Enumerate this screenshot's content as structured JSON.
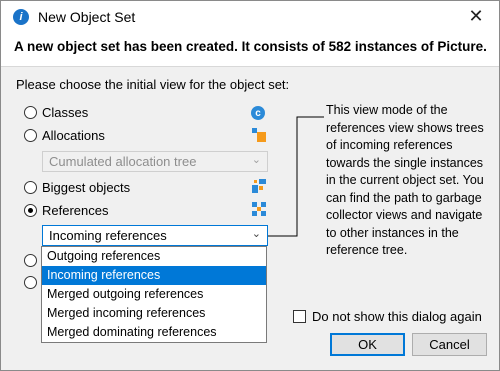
{
  "window": {
    "title": "New Object Set",
    "close_glyph": "✕",
    "app_icon_letter": "i"
  },
  "headline": "A new object set has been created. It consists of 582 instances of Picture.",
  "prompt": "Please choose the initial view for the object set:",
  "options": [
    {
      "label": "Classes",
      "checked": false,
      "icon": "class-c-icon"
    },
    {
      "label": "Allocations",
      "checked": false,
      "icon": "allocation-tree-icon"
    },
    {
      "label": "Biggest objects",
      "checked": false,
      "icon": "biggest-objects-icon"
    },
    {
      "label": "References",
      "checked": true,
      "icon": "references-graph-icon"
    }
  ],
  "classes_icon_letter": "c",
  "allocation_combo": {
    "value": "Cumulated allocation tree",
    "disabled": true
  },
  "references_combo": {
    "value": "Incoming references",
    "options": [
      "Outgoing references",
      "Incoming references",
      "Merged outgoing references",
      "Merged incoming references",
      "Merged dominating references"
    ],
    "selected_index": 1
  },
  "description": "This view mode of the references view shows trees of incoming references towards the single instances in the current object set. You can find the path to garbage collector views and navigate to other instances in the reference tree.",
  "dont_show_label": "Do not show this dialog again",
  "dont_show_checked": false,
  "buttons": {
    "ok": "OK",
    "cancel": "Cancel"
  },
  "colors": {
    "accent": "#0078d7",
    "icon_blue": "#2b8ad8",
    "icon_orange": "#f59a1b"
  }
}
